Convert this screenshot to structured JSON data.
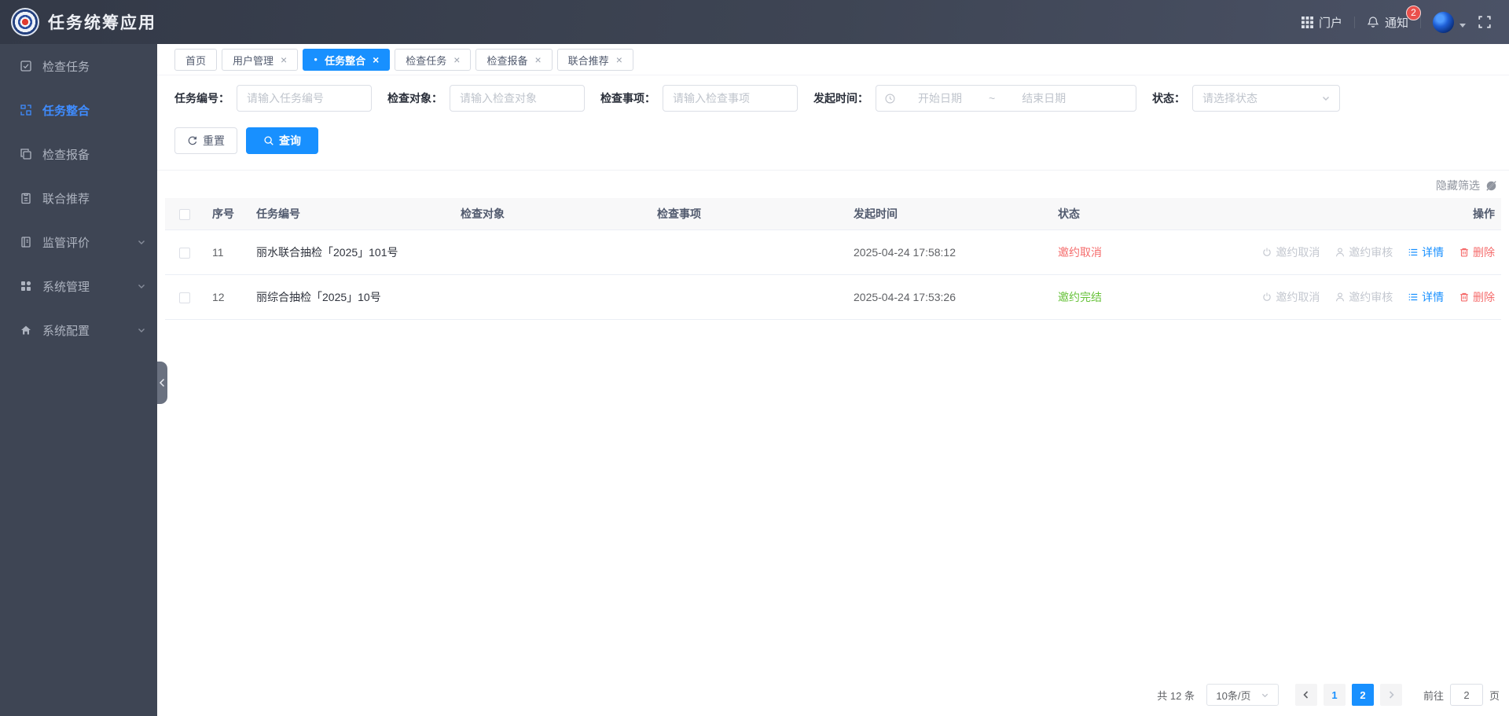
{
  "app": {
    "title": "任务统筹应用"
  },
  "header": {
    "portal_label": "门户",
    "notice_label": "通知",
    "notice_badge": "2"
  },
  "sidebar": {
    "items": [
      {
        "label": "检查任务"
      },
      {
        "label": "任务整合"
      },
      {
        "label": "检查报备"
      },
      {
        "label": "联合推荐"
      },
      {
        "label": "监管评价"
      },
      {
        "label": "系统管理"
      },
      {
        "label": "系统配置"
      }
    ]
  },
  "tabs": [
    {
      "label": "首页"
    },
    {
      "label": "用户管理"
    },
    {
      "label": "任务整合"
    },
    {
      "label": "检查任务"
    },
    {
      "label": "检查报备"
    },
    {
      "label": "联合推荐"
    }
  ],
  "filters": {
    "task_no_label": "任务编号：",
    "task_no_placeholder": "请输入任务编号",
    "object_label": "检查对象：",
    "object_placeholder": "请输入检查对象",
    "item_label": "检查事项：",
    "item_placeholder": "请输入检查事项",
    "time_label": "发起时间：",
    "start_placeholder": "开始日期",
    "range_separator": "~",
    "end_placeholder": "结束日期",
    "status_label": "状态：",
    "status_placeholder": "请选择状态",
    "reset_label": "重置",
    "search_label": "查询",
    "hide_filter_label": "隐藏筛选"
  },
  "table": {
    "headers": [
      "序号",
      "任务编号",
      "检查对象",
      "检查事项",
      "发起时间",
      "状态",
      "操作"
    ],
    "rows": [
      {
        "index": "11",
        "task_no": "丽水联合抽检「2025」101号",
        "object": "",
        "item": "",
        "time": "2025-04-24 17:58:12",
        "status": "邀约取消"
      },
      {
        "index": "12",
        "task_no": "丽综合抽检「2025」10号",
        "object": "",
        "item": "",
        "time": "2025-04-24 17:53:26",
        "status": "邀约完结"
      }
    ],
    "actions": {
      "cancel": "邀约取消",
      "review": "邀约审核",
      "detail": "详情",
      "delete": "删除"
    }
  },
  "pagination": {
    "total": "共 12 条",
    "page_size": "10条/页",
    "pages": [
      "1",
      "2"
    ],
    "goto_label": "前往",
    "goto_value": "2",
    "page_unit": "页"
  },
  "ui": {
    "close_glyph": "×",
    "active_dot": "●"
  },
  "colors": {
    "primary": "#1890ff",
    "danger": "#f56c6c",
    "success": "#67c23a",
    "sidebar_bg": "#3e4554",
    "header_bg": "#3e4554"
  }
}
